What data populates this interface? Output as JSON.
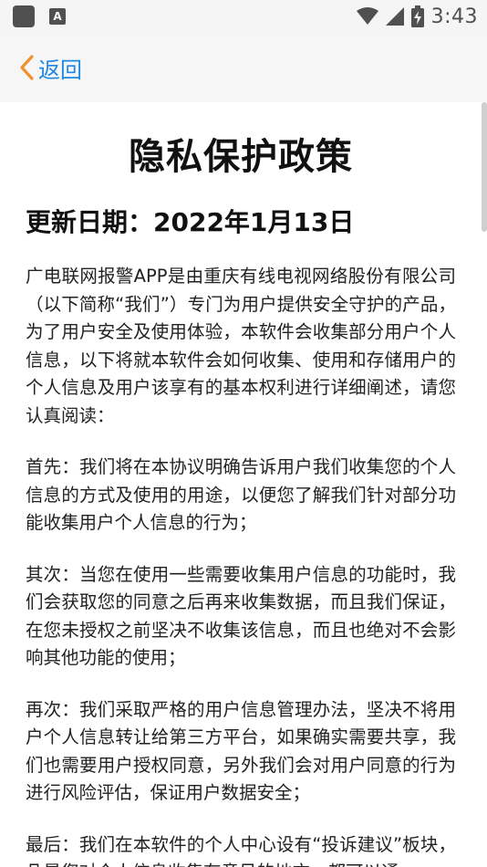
{
  "status_bar": {
    "a_icon_text": "A",
    "time": "3:43"
  },
  "nav": {
    "back_label": "返回"
  },
  "content": {
    "title": "隐私保护政策",
    "update_date": "更新日期：2022年1月13日",
    "paragraphs": [
      "广电联网报警APP是由重庆有线电视网络股份有限公司（以下简称“我们”）专门为用户提供安全守护的产品，为了用户安全及使用体验，本软件会收集部分用户个人信息，以下将就本软件会如何收集、使用和存储用户的个人信息及用户该享有的基本权利进行详细阐述，请您认真阅读：",
      "首先：我们将在本协议明确告诉用户我们收集您的个人信息的方式及使用的用途，以便您了解我们针对部分功能收集用户个人信息的行为；",
      "其次：当您在使用一些需要收集用户信息的功能时，我们会获取您的同意之后再来收集数据，而且我们保证，在您未授权之前坚决不收集该信息，而且也绝对不会影响其他功能的使用；",
      "再次：我们采取严格的用户信息管理办法，坚决不将用户个人信息转让给第三方平台，如果确实需要共享，我们也需要用户授权同意，另外我们会对用户同意的行为进行风险评估，保证用户数据安全；",
      "最后：我们在本软件的个人中心设有“投诉建议”板块，凡是您对个人信息收集有意见的地方，都可以通"
    ]
  },
  "colors": {
    "accent": "#1e88e5",
    "back_chevron": "#f0922b"
  }
}
